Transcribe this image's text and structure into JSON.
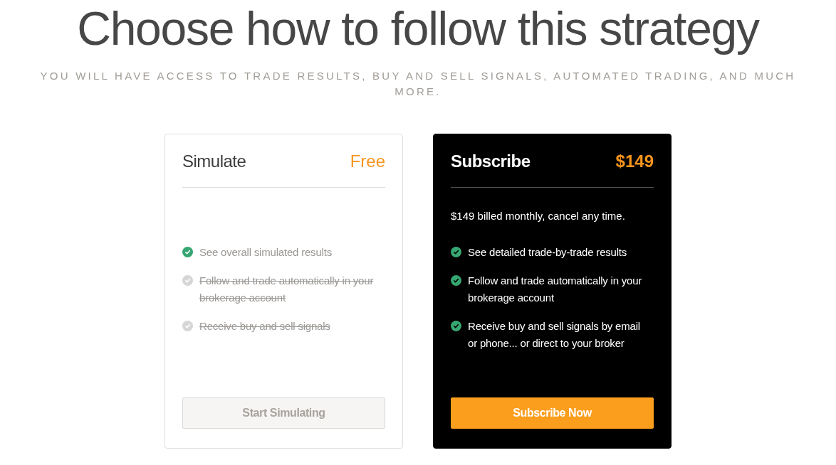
{
  "heading": {
    "title": "Choose how to follow this strategy",
    "subtitle": "YOU WILL HAVE ACCESS TO TRADE RESULTS, BUY AND SELL SIGNALS, AUTOMATED TRADING, AND MUCH MORE."
  },
  "plans": [
    {
      "name": "Simulate",
      "price": "Free",
      "featured": false,
      "features": [
        {
          "label": "See overall simulated results",
          "included": true
        },
        {
          "label": "Follow and trade automatically in your brokerage account",
          "included": false
        },
        {
          "label": "Receive buy and sell signals",
          "included": false
        }
      ],
      "button": {
        "label": "Start Simulating",
        "disabled": true
      }
    },
    {
      "name": "Subscribe",
      "price": "$149",
      "featured": true,
      "description": "$149 billed monthly, cancel any time.",
      "features": [
        {
          "label": "See detailed trade-by-trade results",
          "included": true
        },
        {
          "label": "Follow and trade automatically in your brokerage account",
          "included": true
        },
        {
          "label": "Receive buy and sell signals by email or phone... or direct to your broker",
          "included": true
        }
      ],
      "button": {
        "label": "Subscribe Now",
        "disabled": false
      }
    }
  ]
}
